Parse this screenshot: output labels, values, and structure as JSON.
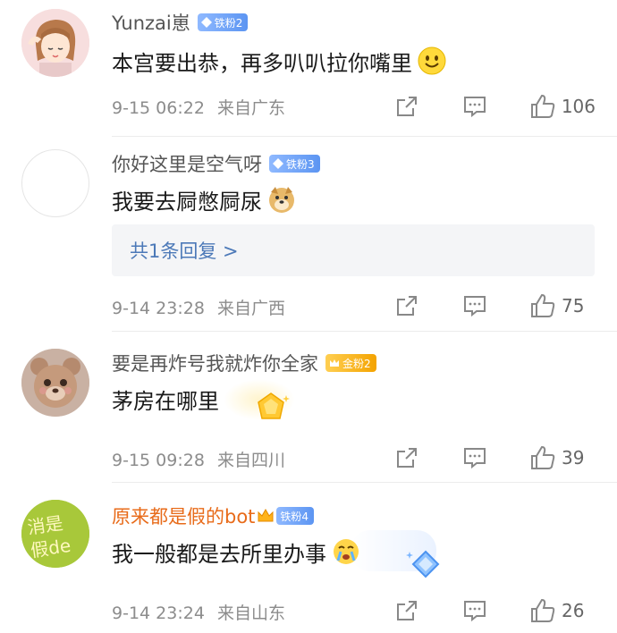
{
  "comments": [
    {
      "name": "Yunzai崽",
      "badge": "铁粉2",
      "text": "本宫要出恭，再多叭叭拉你嘴里",
      "emoji": "smile-emoji",
      "time": "9-15 06:22",
      "location": "来自广东",
      "likes": "106"
    },
    {
      "name": "你好这里是空气呀",
      "badge": "铁粉3",
      "text": "我要去屙憋屙尿",
      "emoji": "doge-emoji",
      "reply": "共1条回复 >",
      "time": "9-14 23:28",
      "location": "来自广西",
      "likes": "75"
    },
    {
      "name": "要是再炸号我就炸你全家",
      "badge": "金粉2",
      "text": "茅房在哪里",
      "time": "9-15 09:28",
      "location": "来自四川",
      "likes": "39"
    },
    {
      "name": "原来都是假的bot",
      "badge": "铁粉4",
      "text": "我一般都是去所里办事",
      "emoji": "tearful-emoji",
      "avatar_text": "消是假de",
      "time": "9-14 23:24",
      "location": "来自山东",
      "likes": "26"
    }
  ],
  "colors": {
    "vip_name": "#e86b1a",
    "reply_link": "#4c79b8",
    "iron_badge": "#5c95f2",
    "gold_badge": "#f4a300"
  }
}
